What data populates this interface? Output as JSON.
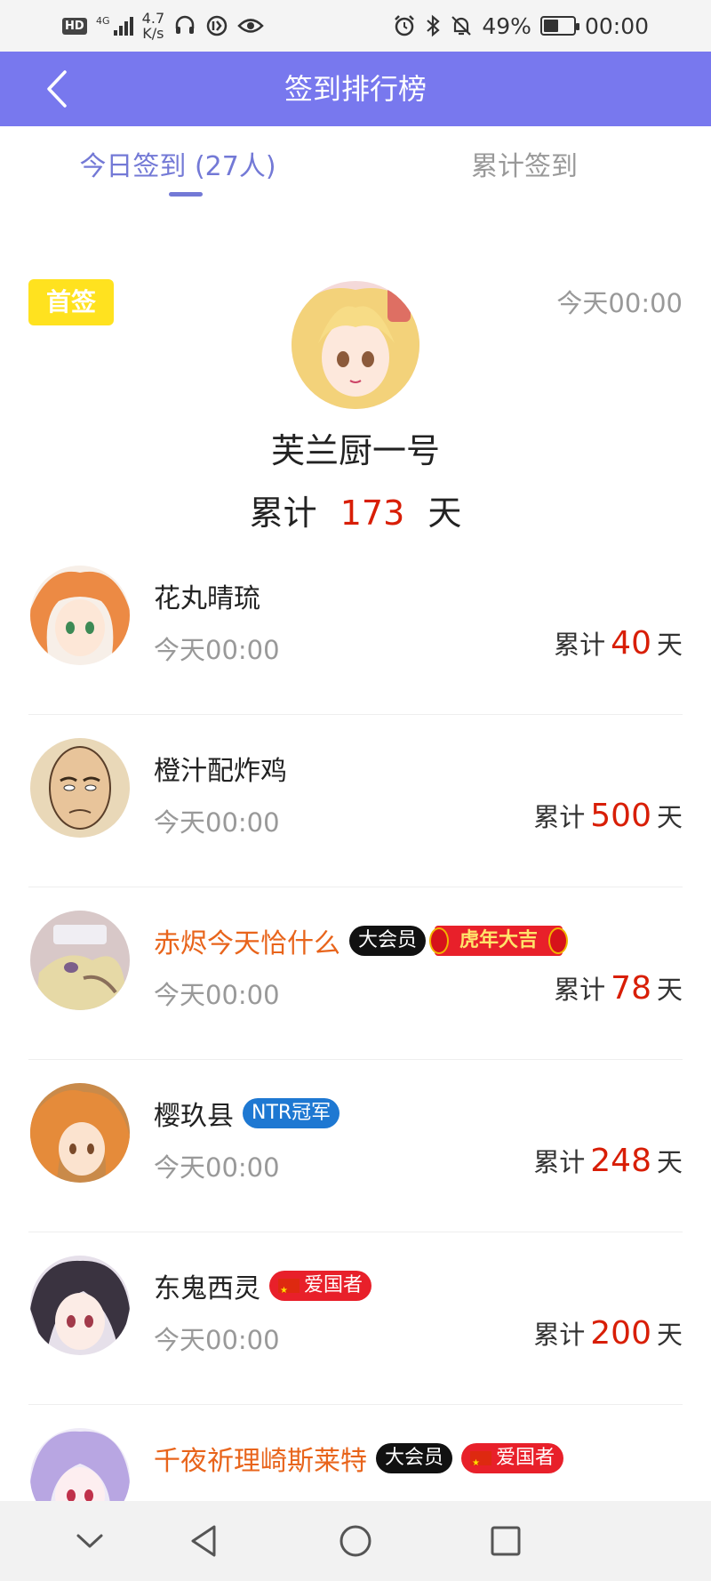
{
  "status_bar": {
    "hd": "HD",
    "network": "4G",
    "speed_value": "4.7",
    "speed_unit": "K/s",
    "battery": "49%",
    "battery_level": 0.49,
    "time": "00:00"
  },
  "header": {
    "title": "签到排行榜"
  },
  "tabs": [
    {
      "label": "今日签到 (27人)",
      "active": true
    },
    {
      "label": "累计签到",
      "active": false
    }
  ],
  "champion": {
    "badge": "首签",
    "time": "今天00:00",
    "name": "芙兰厨一号",
    "total_prefix": "累计",
    "total_days": "173",
    "total_suffix": "天"
  },
  "list": [
    {
      "name": "花丸晴琉",
      "time": "今天00:00",
      "total_prefix": "累计",
      "days": "40",
      "total_suffix": "天"
    },
    {
      "name": "橙汁配炸鸡",
      "time": "今天00:00",
      "total_prefix": "累计",
      "days": "500",
      "total_suffix": "天"
    },
    {
      "name": "赤烬今天恰什么",
      "time": "今天00:00",
      "total_prefix": "累计",
      "days": "78",
      "total_suffix": "天",
      "badge_vip": "大会员",
      "badge_tiger": "虎年大吉"
    },
    {
      "name": "樱玖县",
      "time": "今天00:00",
      "total_prefix": "累计",
      "days": "248",
      "total_suffix": "天",
      "badge_ntr": "NTR冠军"
    },
    {
      "name": "东鬼西灵",
      "time": "今天00:00",
      "total_prefix": "累计",
      "days": "200",
      "total_suffix": "天",
      "badge_patriot": "爱国者"
    },
    {
      "name": "千夜祈理崎斯莱特",
      "badge_vip": "大会员",
      "badge_patriot": "爱国者"
    }
  ],
  "nav_bar": {
    "icons": [
      "chevron-down-icon",
      "back-triangle-icon",
      "home-circle-icon",
      "recents-square-icon"
    ]
  },
  "colors": {
    "header_bg": "#7878ee",
    "accent": "#7379d6",
    "days_red": "#d81e06",
    "vip_name": "#e8641b",
    "first_badge": "#ffe21f"
  }
}
